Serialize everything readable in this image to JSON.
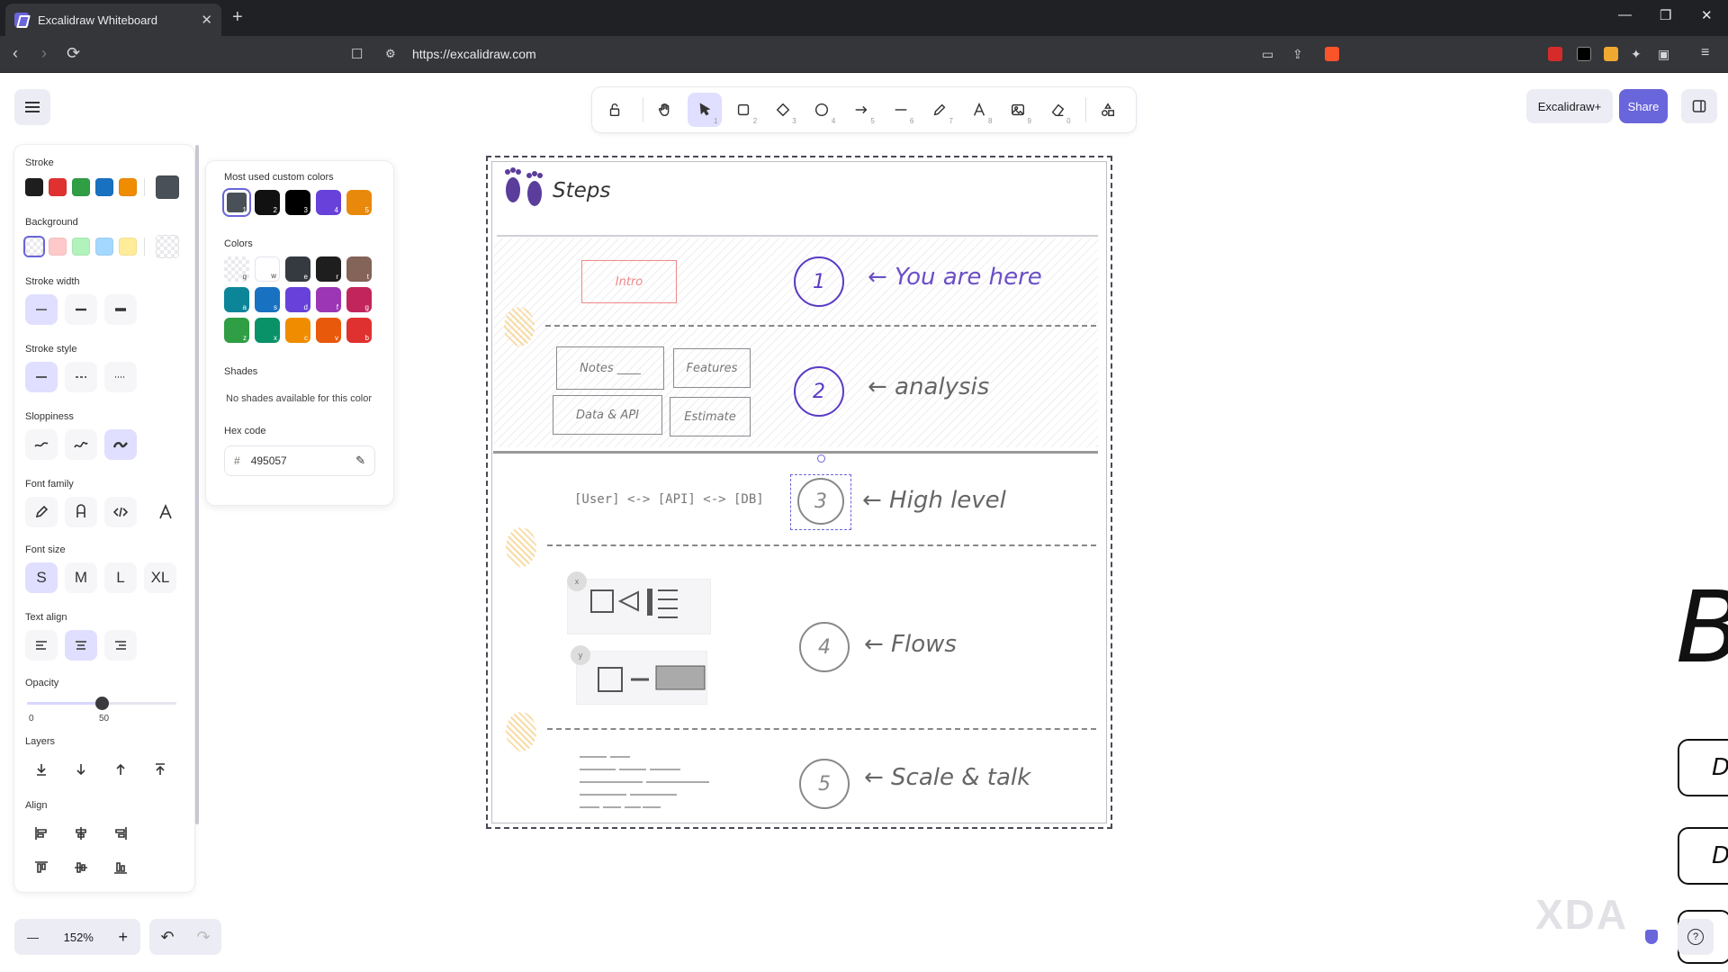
{
  "browser": {
    "tab_title": "Excalidraw Whiteboard",
    "tab_close": "✕",
    "new_tab": "+",
    "url": "https://excalidraw.com",
    "win_min": "—",
    "win_max": "❐",
    "win_close": "✕"
  },
  "toolbar": {
    "tools": [
      {
        "name": "lock",
        "num": ""
      },
      {
        "name": "hand",
        "num": ""
      },
      {
        "name": "selection",
        "num": "1"
      },
      {
        "name": "rectangle",
        "num": "2"
      },
      {
        "name": "diamond",
        "num": "3"
      },
      {
        "name": "ellipse",
        "num": "4"
      },
      {
        "name": "arrow",
        "num": "5"
      },
      {
        "name": "line",
        "num": "6"
      },
      {
        "name": "draw",
        "num": "7"
      },
      {
        "name": "text",
        "num": "8"
      },
      {
        "name": "image",
        "num": "9"
      },
      {
        "name": "eraser",
        "num": "0"
      },
      {
        "name": "more-tools",
        "num": ""
      }
    ]
  },
  "top_right": {
    "plus_label": "Excalidraw+",
    "share_label": "Share"
  },
  "props": {
    "stroke_title": "Stroke",
    "stroke_colors": [
      "#1e1e1e",
      "#e03131",
      "#2f9e44",
      "#1971c2",
      "#f08c00"
    ],
    "stroke_current": "#495057",
    "background_title": "Background",
    "background_colors": [
      "transparent",
      "#ffc9c9",
      "#b2f2bb",
      "#a5d8ff",
      "#ffec99"
    ],
    "stroke_width_title": "Stroke width",
    "stroke_style_title": "Stroke style",
    "sloppiness_title": "Sloppiness",
    "font_family_title": "Font family",
    "font_size_title": "Font size",
    "font_sizes": [
      "S",
      "M",
      "L",
      "XL"
    ],
    "text_align_title": "Text align",
    "opacity_title": "Opacity",
    "opacity_min": "0",
    "opacity_value": "50",
    "opacity_fraction": 0.5,
    "layers_title": "Layers",
    "align_title": "Align"
  },
  "colorpicker": {
    "custom_title": "Most used custom colors",
    "custom": [
      {
        "c": "#495057",
        "k": "1"
      },
      {
        "c": "#111111",
        "k": "2"
      },
      {
        "c": "#000000",
        "k": "3"
      },
      {
        "c": "#6741d9",
        "k": "4"
      },
      {
        "c": "#e8890c",
        "k": "5"
      }
    ],
    "colors_title": "Colors",
    "colors": [
      {
        "c": "transparent",
        "k": "q"
      },
      {
        "c": "#ffffff",
        "k": "w"
      },
      {
        "c": "#343a40",
        "k": "e"
      },
      {
        "c": "#1e1e1e",
        "k": "r"
      },
      {
        "c": "#846358",
        "k": "t"
      },
      {
        "c": "#0c8599",
        "k": "a"
      },
      {
        "c": "#1971c2",
        "k": "s"
      },
      {
        "c": "#6741d9",
        "k": "d"
      },
      {
        "c": "#9c36b5",
        "k": "f"
      },
      {
        "c": "#c2255c",
        "k": "g"
      },
      {
        "c": "#2f9e44",
        "k": "z"
      },
      {
        "c": "#099268",
        "k": "x"
      },
      {
        "c": "#f08c00",
        "k": "c"
      },
      {
        "c": "#e8590c",
        "k": "v"
      },
      {
        "c": "#e03131",
        "k": "b"
      }
    ],
    "shades_title": "Shades",
    "shades_note": "No shades available for this color",
    "hex_title": "Hex code",
    "hex_prefix": "#",
    "hex_value": "495057"
  },
  "zoom": {
    "minus": "—",
    "value": "152%",
    "plus": "+"
  },
  "canvas": {
    "heading": "Steps",
    "steps": [
      {
        "n": "1",
        "label": "← You are here"
      },
      {
        "n": "2",
        "label": "← analysis"
      },
      {
        "n": "3",
        "label": "← High level"
      },
      {
        "n": "4",
        "label": "← Flows"
      },
      {
        "n": "5",
        "label": "← Scale & talk"
      }
    ],
    "intro": "Intro",
    "notes": "Notes ____",
    "features": "Features",
    "data_api": "Data & API",
    "estimate": "Estimate",
    "arch": "[User] <-> [API] <-> [DB]",
    "badge_x": "x",
    "badge_y": "y",
    "partial_big": "B",
    "partial_1": "D",
    "partial_2": "De"
  },
  "help": "?",
  "watermark": "XDA"
}
